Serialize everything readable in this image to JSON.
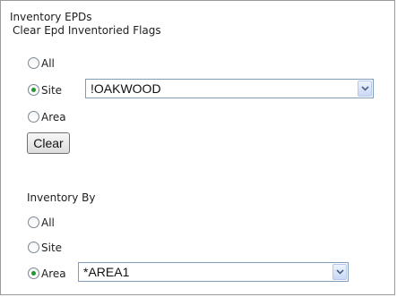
{
  "inventory_epds": {
    "title": "Inventory EPDs",
    "subtitle": "Clear Epd Inventoried Flags",
    "options": [
      {
        "label": "All",
        "selected": false
      },
      {
        "label": "Site",
        "selected": true
      },
      {
        "label": "Area",
        "selected": false
      }
    ],
    "site_select": {
      "value": "!OAKWOOD"
    },
    "clear_label": "Clear"
  },
  "inventory_by": {
    "title": "Inventory By",
    "options": [
      {
        "label": "All",
        "selected": false
      },
      {
        "label": "Site",
        "selected": false
      },
      {
        "label": "Area",
        "selected": true
      }
    ],
    "area_select": {
      "value": "*AREA1"
    }
  },
  "icons": {
    "dropdown": "chevron-down-icon"
  },
  "colors": {
    "radio_checked": "#1f9a2c",
    "select_border": "#7f9db9"
  }
}
